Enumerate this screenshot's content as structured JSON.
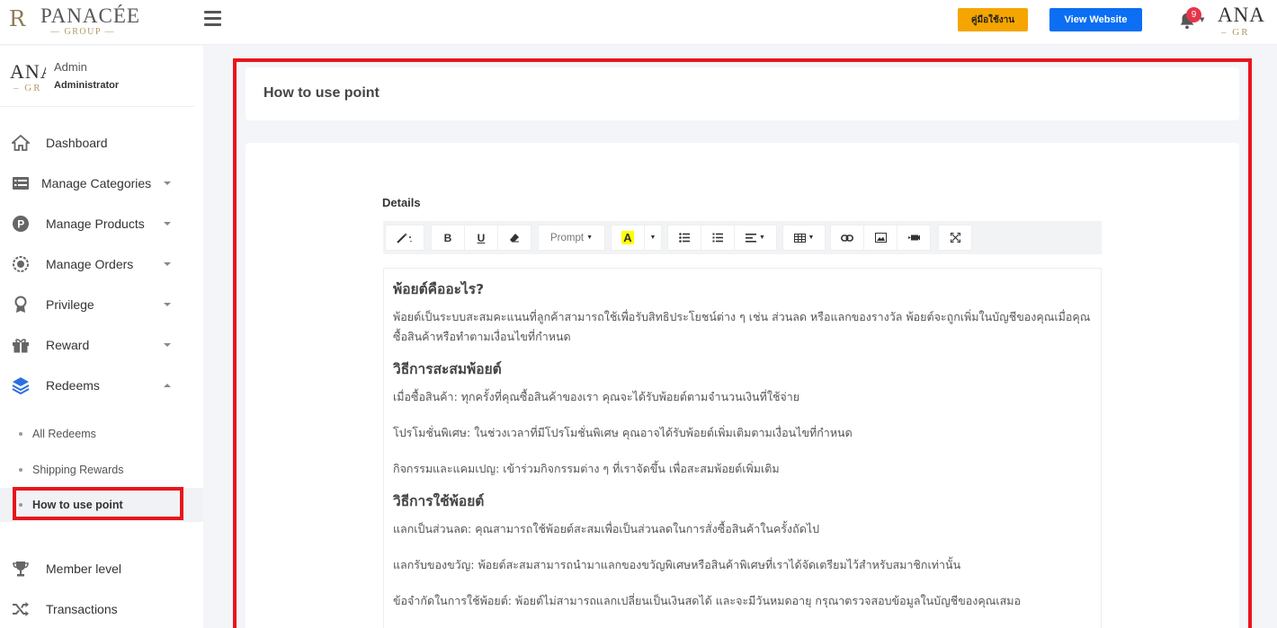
{
  "header": {
    "logo_monogram": "R",
    "logo_brand": "PANACÉE",
    "logo_sub": "— GROUP —",
    "manual_label": "คู่มือใช้งาน",
    "website_label": "View Website",
    "notification_count": "9",
    "avatar_big": "ANA",
    "avatar_small": "– GR"
  },
  "profile": {
    "avatar_big": "ANA",
    "avatar_small": "– GR",
    "role": "Admin",
    "role_sub": "Administrator"
  },
  "sidebar": {
    "items": [
      {
        "label": "Dashboard"
      },
      {
        "label": "Manage Categories"
      },
      {
        "label": "Manage Products"
      },
      {
        "label": "Manage Orders"
      },
      {
        "label": "Privilege"
      },
      {
        "label": "Reward"
      },
      {
        "label": "Redeems"
      },
      {
        "label": "Member level"
      },
      {
        "label": "Transactions"
      }
    ],
    "redeems_sub": [
      {
        "label": "All Redeems"
      },
      {
        "label": "Shipping Rewards"
      },
      {
        "label": "How to use point"
      }
    ]
  },
  "page": {
    "title": "How to use point",
    "details_label": "Details"
  },
  "toolbar": {
    "bold": "B",
    "underline": "U",
    "prompt": "Prompt",
    "font_color": "A"
  },
  "editor": {
    "h1": "พ้อยต์คืออะไร?",
    "p1": "พ้อยต์เป็นระบบสะสมคะแนนที่ลูกค้าสามารถใช้เพื่อรับสิทธิประโยชน์ต่าง ๆ เช่น ส่วนลด หรือแลกของรางวัล พ้อยต์จะถูกเพิ่มในบัญชีของคุณเมื่อคุณซื้อสินค้าหรือทำตามเงื่อนไขที่กำหนด",
    "h2": "วิธีการสะสมพ้อยต์",
    "p2": "เมื่อซื้อสินค้า: ทุกครั้งที่คุณซื้อสินค้าของเรา คุณจะได้รับพ้อยต์ตามจำนวนเงินที่ใช้จ่าย",
    "p3": "โปรโมชั่นพิเศษ: ในช่วงเวลาที่มีโปรโมชั่นพิเศษ คุณอาจได้รับพ้อยต์เพิ่มเติมตามเงื่อนไขที่กำหนด",
    "p4": "กิจกรรมและแคมเปญ: เข้าร่วมกิจกรรมต่าง ๆ ที่เราจัดขึ้น เพื่อสะสมพ้อยต์เพิ่มเติม",
    "h3": "วิธีการใช้พ้อยต์",
    "p5": "แลกเป็นส่วนลด: คุณสามารถใช้พ้อยต์สะสมเพื่อเป็นส่วนลดในการสั่งซื้อสินค้าในครั้งถัดไป",
    "p6": "แลกรับของขวัญ: พ้อยต์สะสมสามารถนำมาแลกของขวัญพิเศษหรือสินค้าพิเศษที่เราได้จัดเตรียมไว้สำหรับสมาชิกเท่านั้น",
    "p7": "ข้อจำกัดในการใช้พ้อยต์: พ้อยต์ไม่สามารถแลกเปลี่ยนเป็นเงินสดได้ และจะมีวันหมดอายุ กรุณาตรวจสอบข้อมูลในบัญชีของคุณเสมอ"
  },
  "colors": {
    "highlight": "#e8161c",
    "manual_button": "#f5a500",
    "website_button": "#0b6ef3",
    "badge": "#e5354b",
    "redeems_icon": "#2c6fe0"
  }
}
